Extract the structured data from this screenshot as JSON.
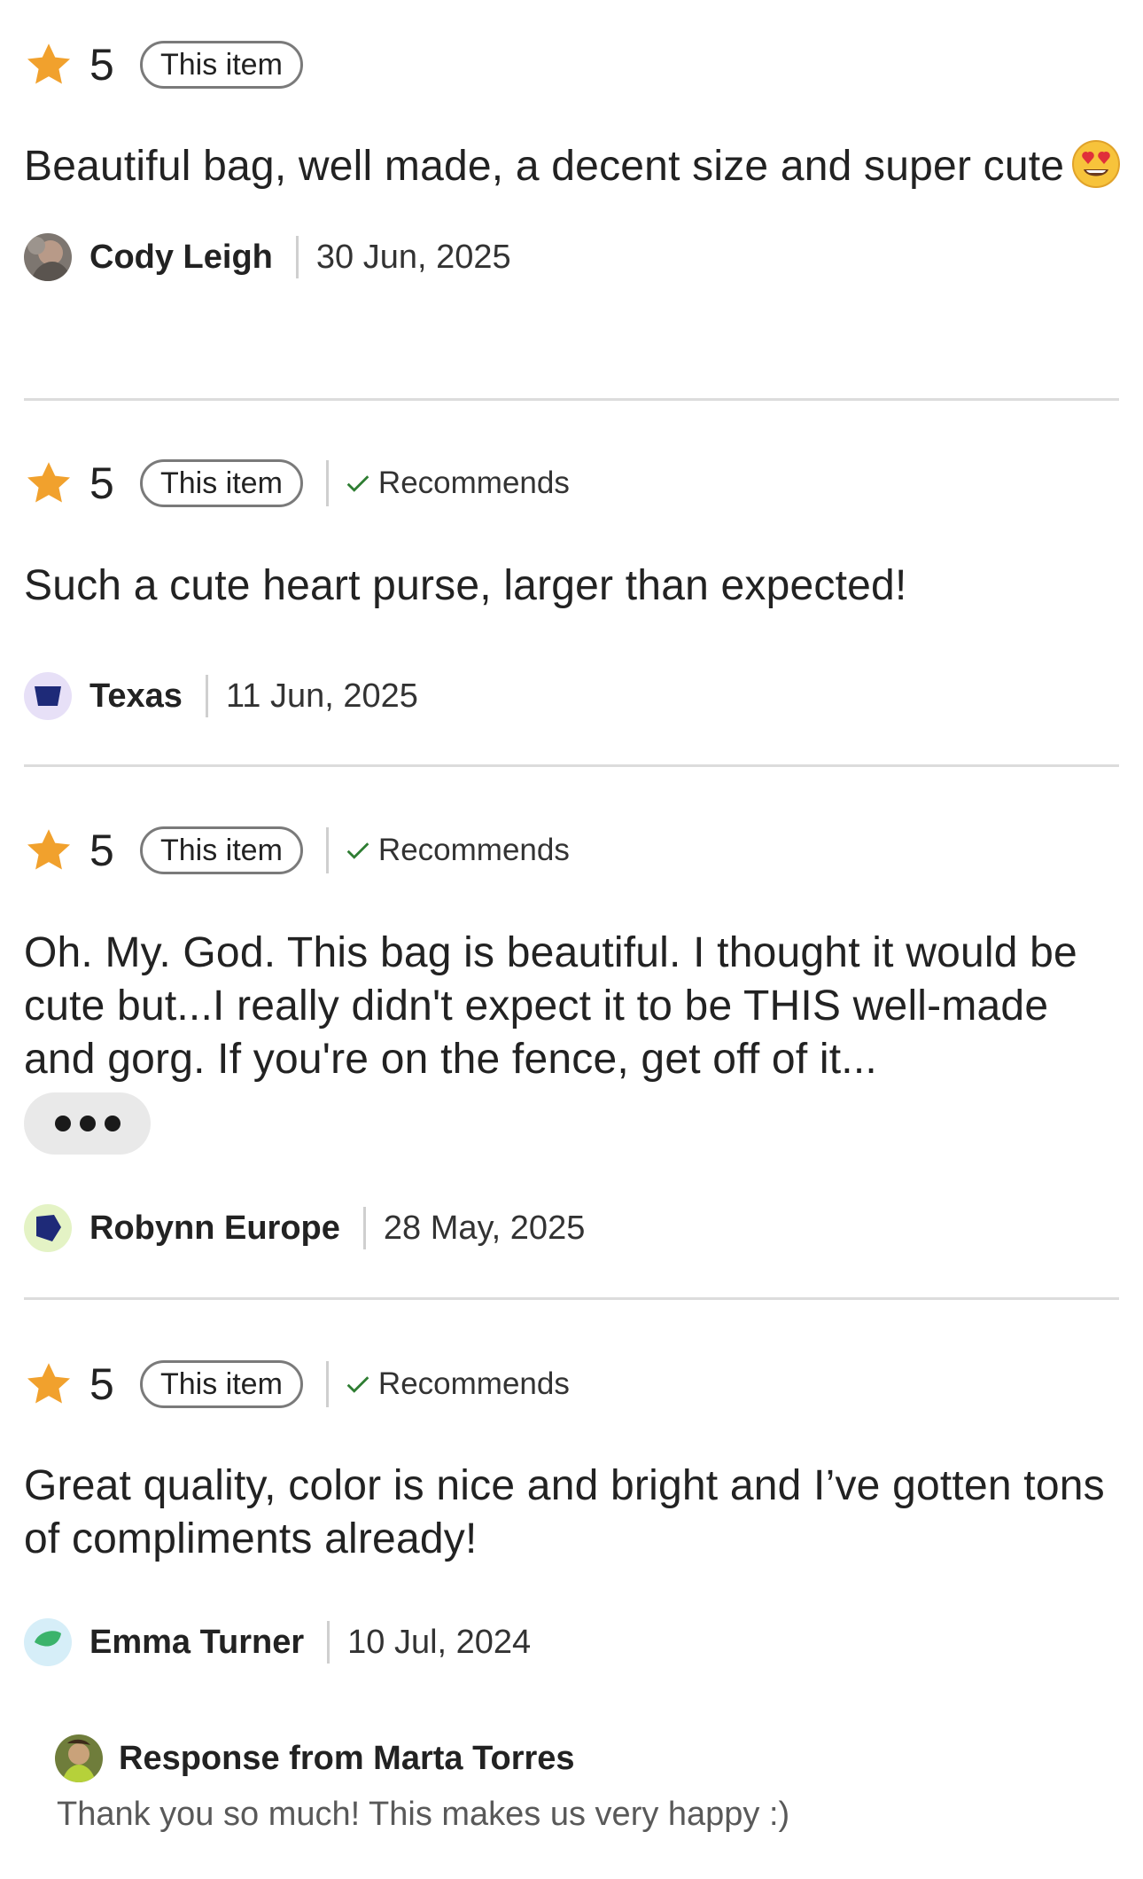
{
  "reviews": [
    {
      "score": "5",
      "tag": "This item",
      "recommends": "",
      "text": "Beautiful bag, well made, a decent size and super cute",
      "has_emoji": true,
      "author": "Cody Leigh",
      "date": "30 Jun, 2025",
      "avatar": "photo-avatar"
    },
    {
      "score": "5",
      "tag": "This item",
      "recommends": "Recommends",
      "text": "Such a cute heart purse, larger than expected!",
      "author": "Texas",
      "date": "11 Jun, 2025",
      "avatar": "shape-avatar-lavender"
    },
    {
      "score": "5",
      "tag": "This item",
      "recommends": "Recommends",
      "text": "Oh. My. God. This bag is beautiful. I thought it would be cute but...I really didn't expect it to be THIS well-made and gorg. If you're on the fence, get off of it...",
      "author": "Robynn Europe",
      "date": "28 May, 2025",
      "avatar": "shape-avatar-lime"
    },
    {
      "score": "5",
      "tag": "This item",
      "recommends": "Recommends",
      "text": "Great quality, color is nice and bright and I’ve gotten tons of compliments already!",
      "author": "Emma Turner",
      "date": "10 Jul, 2024",
      "avatar": "shape-avatar-skyblue"
    }
  ],
  "response": {
    "title": "Response from Marta Torres",
    "text": "Thank you so much! This makes us very happy :)"
  },
  "colors": {
    "star": "#F1A12D",
    "divider": "#DCDCDC",
    "text": "#222222",
    "muted": "#595959",
    "check": "#2E7D32"
  },
  "icons": {
    "star": "star-icon",
    "check": "check-icon",
    "more": "more-dots-icon",
    "emoji": "heart-eyes-emoji-icon"
  }
}
